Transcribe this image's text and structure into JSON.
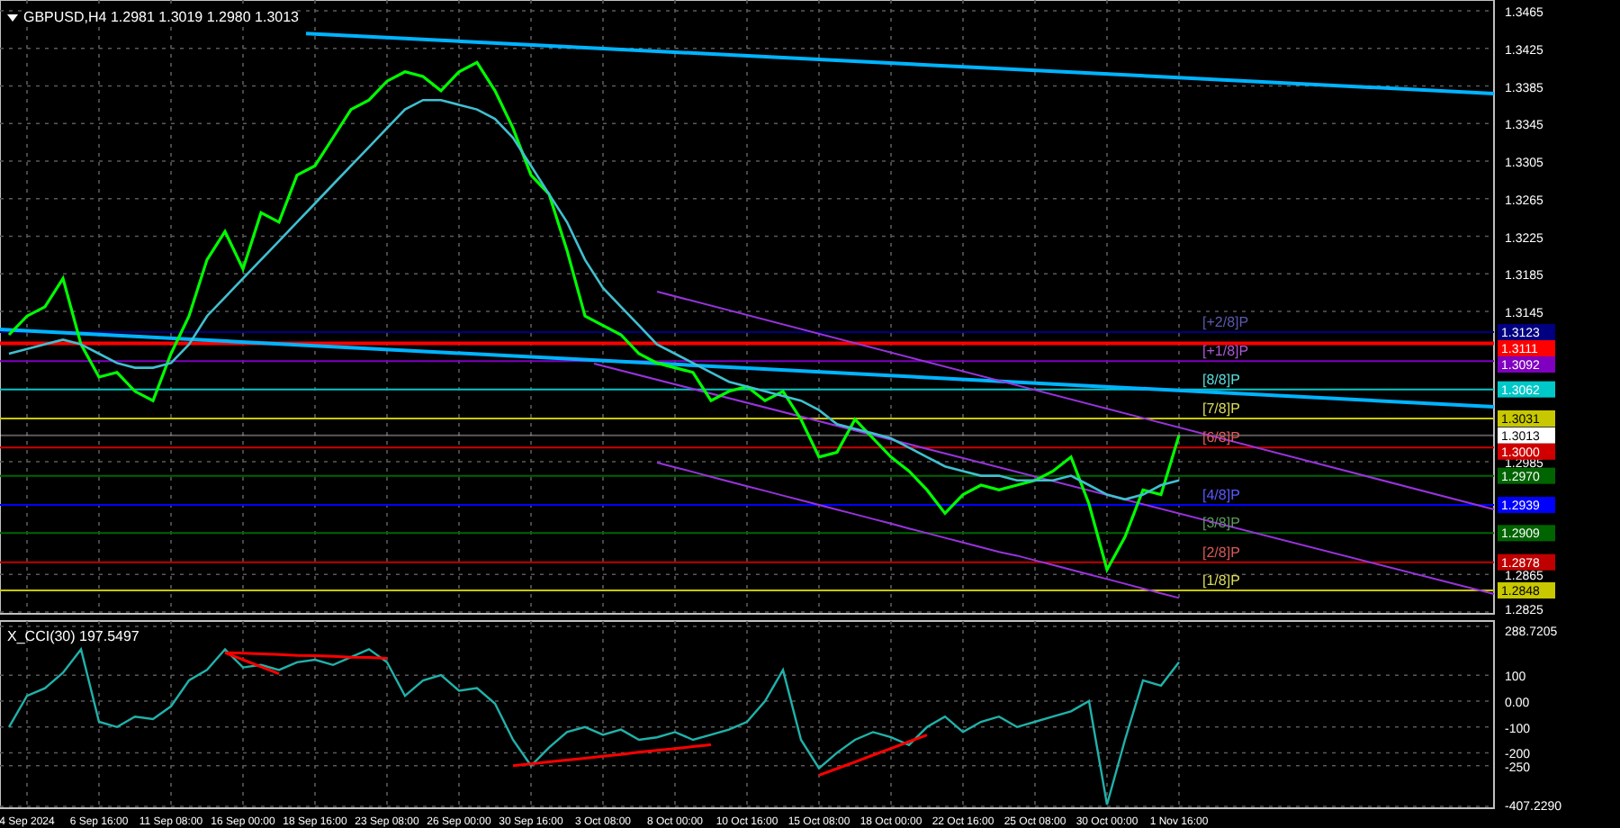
{
  "price_chart": {
    "title": "GBPUSD,H4  1.2981 1.3019 1.2980 1.3013",
    "chart_data": {
      "type": "line",
      "grid": true,
      "ylim": [
        1.2825,
        1.34765
      ],
      "yticks": [
        1.3465,
        1.3425,
        1.3385,
        1.3345,
        1.3305,
        1.3265,
        1.3225,
        1.3185,
        1.3145,
        1.2985,
        1.2865,
        1.2825
      ],
      "series": [
        {
          "color": "#00ff00",
          "values": [
            1.312,
            1.314,
            1.315,
            1.318,
            1.311,
            1.3075,
            1.308,
            1.306,
            1.305,
            1.31,
            1.314,
            1.32,
            1.323,
            1.319,
            1.325,
            1.324,
            1.329,
            1.33,
            1.333,
            1.336,
            1.337,
            1.339,
            1.34,
            1.3395,
            1.338,
            1.34,
            1.341,
            1.338,
            1.334,
            1.329,
            1.327,
            1.321,
            1.314,
            1.313,
            1.312,
            1.31,
            1.309,
            1.3085,
            1.308,
            1.305,
            1.306,
            1.3065,
            1.305,
            1.306,
            1.303,
            1.299,
            1.2995,
            1.303,
            1.301,
            1.299,
            1.2975,
            1.2955,
            1.293,
            1.295,
            1.296,
            1.2955,
            1.296,
            1.2965,
            1.2975,
            1.299,
            1.294,
            1.287,
            1.2905,
            1.2955,
            1.295,
            1.3013
          ]
        },
        {
          "color": "#40c0d0",
          "values": [
            1.31,
            1.3105,
            1.311,
            1.3115,
            1.311,
            1.31,
            1.309,
            1.3085,
            1.3085,
            1.309,
            1.311,
            1.314,
            1.316,
            1.318,
            1.32,
            1.322,
            1.324,
            1.326,
            1.328,
            1.33,
            1.332,
            1.334,
            1.336,
            1.337,
            1.337,
            1.3365,
            1.336,
            1.335,
            1.333,
            1.33,
            1.327,
            1.324,
            1.32,
            1.317,
            1.315,
            1.313,
            1.311,
            1.31,
            1.309,
            1.308,
            1.307,
            1.3065,
            1.306,
            1.3055,
            1.305,
            1.304,
            1.3025,
            1.302,
            1.3015,
            1.301,
            1.3,
            1.299,
            1.298,
            1.2975,
            1.297,
            1.297,
            1.2965,
            1.2965,
            1.2965,
            1.297,
            1.296,
            1.295,
            1.2945,
            1.295,
            1.296,
            1.2965
          ]
        },
        {
          "color": "#9933dd",
          "values": [
            null,
            null,
            null,
            null,
            null,
            null,
            null,
            null,
            null,
            null,
            null,
            null,
            null,
            null,
            null,
            null,
            null,
            null,
            null,
            null,
            null,
            null,
            null,
            null,
            null,
            null,
            null,
            null,
            null,
            null,
            null,
            null,
            null,
            null,
            null,
            null,
            1.2984,
            1.2979,
            1.2974,
            1.2969,
            1.2964,
            1.2959,
            1.2954,
            1.2949,
            1.2944,
            1.2939,
            1.2934,
            1.2929,
            1.2924,
            1.2919,
            1.2914,
            1.2909,
            1.2904,
            1.2899,
            1.2894,
            1.2889,
            1.2885,
            1.288,
            1.2875,
            1.287,
            1.2865,
            1.286,
            1.2855,
            1.285,
            1.2845,
            1.284
          ]
        }
      ],
      "ref_lines": [
        {
          "axis": "y",
          "value": 1.3123,
          "color": "#000080",
          "label": "1.3123"
        },
        {
          "axis": "y",
          "value": 1.3111,
          "color": "#ff0000",
          "label": "1.3111"
        },
        {
          "axis": "y",
          "value": 1.3092,
          "color": "#8000c0",
          "label": "1.3092"
        },
        {
          "axis": "y",
          "value": 1.3062,
          "color": "#00c8c8",
          "label": "1.3062"
        },
        {
          "axis": "y",
          "value": 1.3031,
          "color": "#c8c800",
          "label": "1.3031"
        },
        {
          "axis": "y",
          "value": 1.3013,
          "color": "#ffffff",
          "label": "1.3013"
        },
        {
          "axis": "y",
          "value": 1.3,
          "color": "#d00000",
          "label": "1.3000"
        },
        {
          "axis": "y",
          "value": 1.297,
          "color": "#006400",
          "label": "1.2970"
        },
        {
          "axis": "y",
          "value": 1.2939,
          "color": "#0000ff",
          "label": "1.2939"
        },
        {
          "axis": "y",
          "value": 1.2909,
          "color": "#006400",
          "label": "1.2909"
        },
        {
          "axis": "y",
          "value": 1.2878,
          "color": "#c00000",
          "label": "1.2878"
        },
        {
          "axis": "y",
          "value": 1.2848,
          "color": "#c8c800",
          "label": "1.2848"
        }
      ],
      "annotations": [
        {
          "text": "[+2/8]P",
          "y": 1.3123
        },
        {
          "text": "[+1/8]P",
          "y": 1.3092
        },
        {
          "text": "[8/8]P",
          "y": 1.3062
        },
        {
          "text": "[7/8]P",
          "y": 1.3031
        },
        {
          "text": "[6/8]P",
          "y": 1.3
        },
        {
          "text": "[4/8]P",
          "y": 1.2939
        },
        {
          "text": "[3/8]P",
          "y": 1.2909
        },
        {
          "text": "[2/8]P",
          "y": 1.2878
        },
        {
          "text": "[1/8]P",
          "y": 1.2848
        }
      ]
    }
  },
  "indicator": {
    "title": "X_CCI(30) 197.5497",
    "chart_data": {
      "type": "line",
      "grid": true,
      "ylim": [
        -407.229,
        288.7205
      ],
      "categories": [
        null,
        "4 Sep 2024",
        null,
        null,
        null,
        "6 Sep 16:00",
        null,
        null,
        null,
        "11 Sep 08:00",
        null,
        null,
        null,
        "16 Sep 00:00",
        null,
        null,
        null,
        "18 Sep 16:00",
        null,
        null,
        null,
        "23 Sep 08:00",
        null,
        null,
        null,
        "26 Sep 00:00",
        null,
        null,
        null,
        "30 Sep 16:00",
        null,
        null,
        null,
        "3 Oct 08:00",
        null,
        null,
        null,
        "8 Oct 00:00",
        null,
        null,
        null,
        "10 Oct 16:00",
        null,
        null,
        null,
        "15 Oct 08:00",
        null,
        null,
        null,
        "18 Oct 00:00",
        null,
        null,
        null,
        "22 Oct 16:00",
        null,
        null,
        null,
        "25 Oct 08:00",
        null,
        null,
        null,
        "30 Oct 00:00",
        null,
        null,
        null,
        "1 Nov 16:00"
      ],
      "yticks": [
        {
          "value": 288.7205,
          "label": "288.7205"
        },
        100,
        {
          "value": 0,
          "label": "0.00"
        },
        -100,
        -200,
        -250,
        {
          "value": -407.229,
          "label": "-407.2290"
        }
      ],
      "series": [
        {
          "color": "#20b2aa",
          "values": [
            -100,
            20,
            50,
            110,
            200,
            -80,
            -100,
            -60,
            -70,
            -20,
            80,
            120,
            200,
            130,
            140,
            120,
            150,
            160,
            140,
            170,
            200,
            150,
            20,
            80,
            100,
            40,
            50,
            -10,
            -150,
            -250,
            -180,
            -120,
            -100,
            -130,
            -110,
            -150,
            -140,
            -120,
            -150,
            -130,
            -110,
            -80,
            0,
            120,
            -150,
            -260,
            -200,
            -150,
            -120,
            -140,
            -170,
            -100,
            -60,
            -120,
            -80,
            -60,
            -100,
            -80,
            -60,
            -40,
            0,
            -400,
            -150,
            80,
            60,
            150
          ]
        },
        {
          "color": "#ff0000",
          "values": [
            null,
            null,
            null,
            null,
            null,
            null,
            null,
            null,
            null,
            null,
            null,
            null,
            187,
            185,
            182,
            180,
            177,
            175,
            173,
            170,
            168,
            165,
            null,
            null,
            null,
            null,
            null,
            null,
            null,
            null,
            null,
            null,
            null,
            null,
            null,
            null,
            null,
            null,
            null,
            null,
            null,
            null,
            null,
            null,
            null,
            null,
            null,
            null,
            null,
            null,
            null,
            null,
            null,
            null,
            null,
            null,
            null,
            null,
            null,
            null,
            null,
            null,
            null,
            null,
            null,
            null
          ]
        },
        {
          "color": "#ff0000",
          "values": [
            null,
            null,
            null,
            null,
            null,
            null,
            null,
            null,
            null,
            null,
            null,
            null,
            187,
            160,
            133,
            106,
            null,
            null,
            null,
            null,
            null,
            null,
            null,
            null,
            null,
            null,
            null,
            null,
            null,
            null,
            null,
            null,
            null,
            null,
            null,
            null,
            null,
            null,
            null,
            null,
            null,
            null,
            null,
            null,
            null,
            null,
            null,
            null,
            null,
            null,
            null,
            null,
            null,
            null,
            null,
            null,
            null,
            null,
            null,
            null,
            null,
            null,
            null,
            null,
            null,
            null
          ]
        },
        {
          "color": "#ff0000",
          "values": [
            null,
            null,
            null,
            null,
            null,
            null,
            null,
            null,
            null,
            null,
            null,
            null,
            null,
            null,
            null,
            null,
            null,
            null,
            null,
            null,
            null,
            null,
            null,
            null,
            null,
            null,
            null,
            null,
            -250,
            -243,
            -235,
            -228,
            -221,
            -213,
            -206,
            -198,
            -191,
            -184,
            -176,
            -169,
            null,
            null,
            null,
            null,
            null,
            null,
            null,
            null,
            null,
            null,
            null,
            null,
            null,
            null,
            null,
            null,
            null,
            null,
            null,
            null,
            null,
            null,
            null,
            null,
            null,
            null
          ]
        },
        {
          "color": "#ff0000",
          "values": [
            null,
            null,
            null,
            null,
            null,
            null,
            null,
            null,
            null,
            null,
            null,
            null,
            null,
            null,
            null,
            null,
            null,
            null,
            null,
            null,
            null,
            null,
            null,
            null,
            null,
            null,
            null,
            null,
            null,
            null,
            null,
            null,
            null,
            null,
            null,
            null,
            null,
            null,
            null,
            null,
            null,
            null,
            null,
            null,
            null,
            -287,
            -261,
            -235,
            -209,
            -183,
            -157,
            -131,
            null,
            null,
            null,
            null,
            null,
            null,
            null,
            null,
            null,
            null,
            null,
            null,
            null,
            null
          ]
        }
      ]
    }
  }
}
